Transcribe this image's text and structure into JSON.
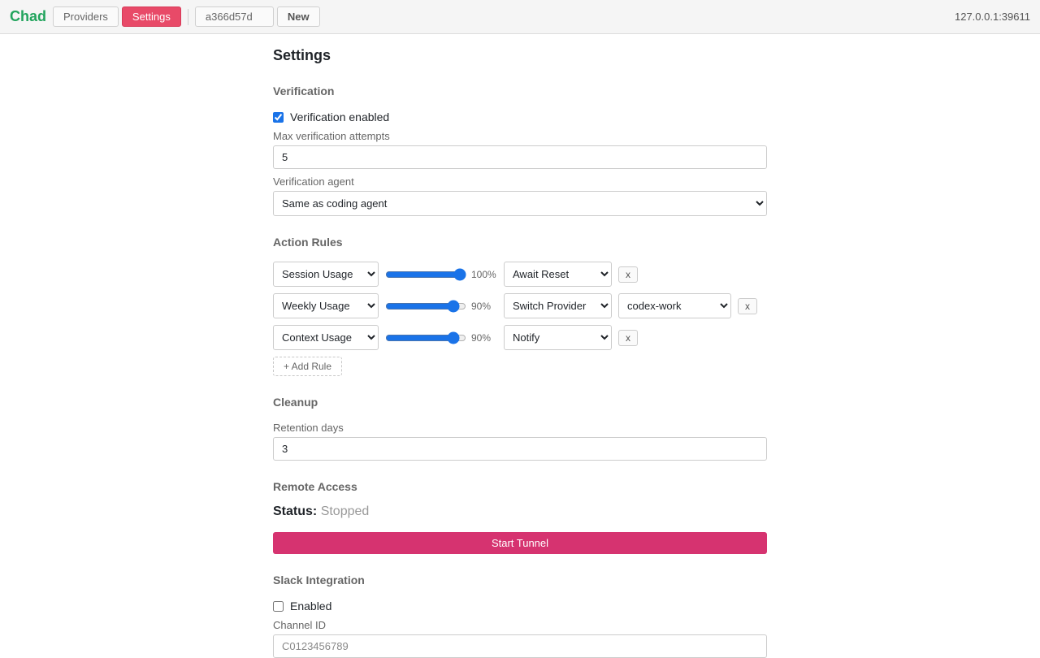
{
  "topbar": {
    "brand": "Chad",
    "tabs": [
      {
        "label": "Providers",
        "active": false
      },
      {
        "label": "Settings",
        "active": true
      }
    ],
    "session_id": "a366d57d",
    "new_label": "New",
    "host": "127.0.0.1:39611"
  },
  "page": {
    "title": "Settings"
  },
  "verification": {
    "title": "Verification",
    "enabled_label": "Verification enabled",
    "enabled": true,
    "max_attempts_label": "Max verification attempts",
    "max_attempts_value": "5",
    "agent_label": "Verification agent",
    "agent_value": "Same as coding agent"
  },
  "action_rules": {
    "title": "Action Rules",
    "rules": [
      {
        "metric": "Session Usage",
        "threshold": 100,
        "threshold_label": "100%",
        "action": "Await Reset",
        "provider": null,
        "remove_label": "x"
      },
      {
        "metric": "Weekly Usage",
        "threshold": 90,
        "threshold_label": "90%",
        "action": "Switch Provider",
        "provider": "codex-work",
        "remove_label": "x"
      },
      {
        "metric": "Context Usage",
        "threshold": 90,
        "threshold_label": "90%",
        "action": "Notify",
        "provider": null,
        "remove_label": "x"
      }
    ],
    "add_label": "+ Add Rule"
  },
  "cleanup": {
    "title": "Cleanup",
    "retention_label": "Retention days",
    "retention_value": "3"
  },
  "remote_access": {
    "title": "Remote Access",
    "status_key": "Status:",
    "status_value": "Stopped",
    "start_label": "Start Tunnel"
  },
  "slack": {
    "title": "Slack Integration",
    "enabled_label": "Enabled",
    "enabled": false,
    "channel_label": "Channel ID",
    "channel_placeholder": "C0123456789"
  },
  "colors": {
    "brand": "#22a45d",
    "active_tab": "#e84a68",
    "tunnel_button": "#d63370",
    "accent": "#1a73e8"
  }
}
